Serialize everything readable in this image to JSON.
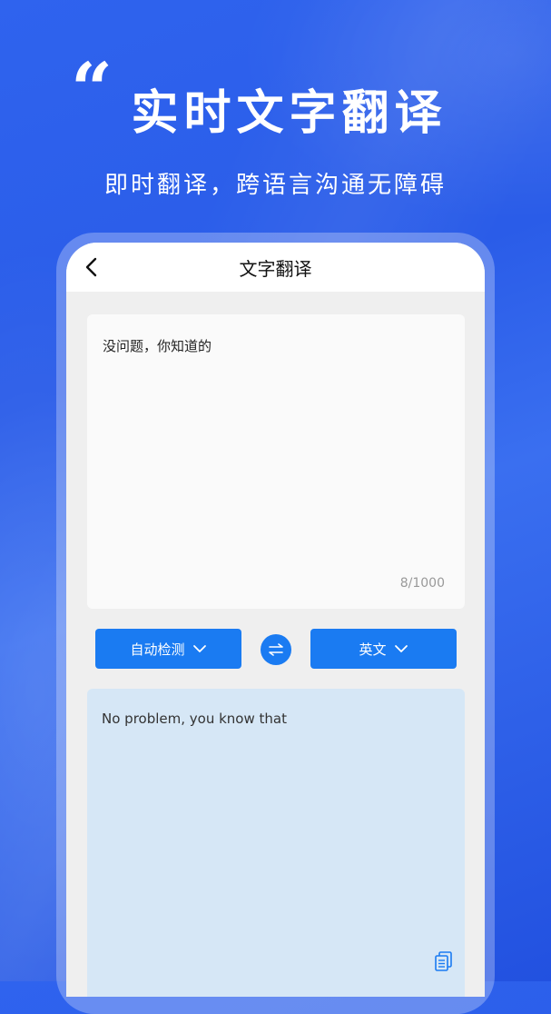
{
  "banner": {
    "quote_mark": "“",
    "headline": "实时文字翻译",
    "subline": "即时翻译，跨语言沟通无障碍"
  },
  "screen": {
    "nav": {
      "back_icon": "chevron-left-icon",
      "title": "文字翻译"
    },
    "source": {
      "text": "没问题，你知道的",
      "char_count": "8/1000"
    },
    "language_bar": {
      "source_lang": "自动检测",
      "target_lang": "英文",
      "swap_icon": "swap-arrows-icon",
      "dropdown_icon": "chevron-down-icon"
    },
    "result": {
      "text": "No problem, you know that",
      "copy_icon": "copy-icon"
    }
  },
  "colors": {
    "background": "#2f63ee",
    "accent": "#1a7bf2",
    "result_bg": "#d6e7f6"
  }
}
